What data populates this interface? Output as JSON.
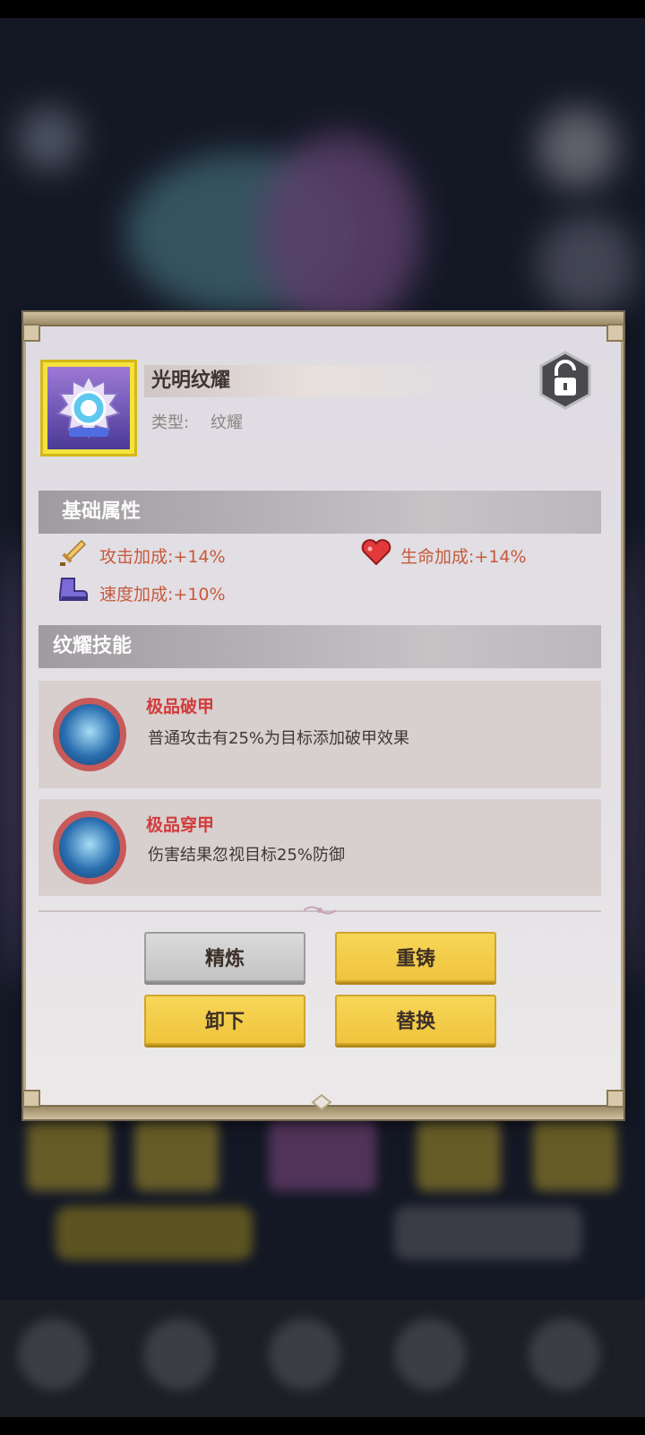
{
  "item": {
    "name": "光明纹耀",
    "type_label": "类型:",
    "type_value": "纹耀",
    "lock_icon": "unlock-icon",
    "frame_color": "#f3e33c"
  },
  "sections": {
    "basic_attributes": "基础属性",
    "skills": "纹耀技能"
  },
  "attributes": [
    {
      "icon": "sword-icon",
      "text": "攻击加成:+14%"
    },
    {
      "icon": "heart-icon",
      "text": "生命加成:+14%"
    },
    {
      "icon": "boot-icon",
      "text": "速度加成:+10%"
    }
  ],
  "skills": [
    {
      "icon": "armor-break-icon",
      "name": "极品破甲",
      "desc": "普通攻击有25%为目标添加破甲效果"
    },
    {
      "icon": "armor-pierce-icon",
      "name": "极品穿甲",
      "desc": "伤害结果忽视目标25%防御"
    }
  ],
  "buttons": {
    "refine": "精炼",
    "recast": "重铸",
    "unequip": "卸下",
    "replace": "替换"
  },
  "colors": {
    "attr_text": "#c65a3b",
    "skill_name": "#d23b3b",
    "yellow_button": "#f2c844",
    "grey_button": "#cfcfcf"
  }
}
